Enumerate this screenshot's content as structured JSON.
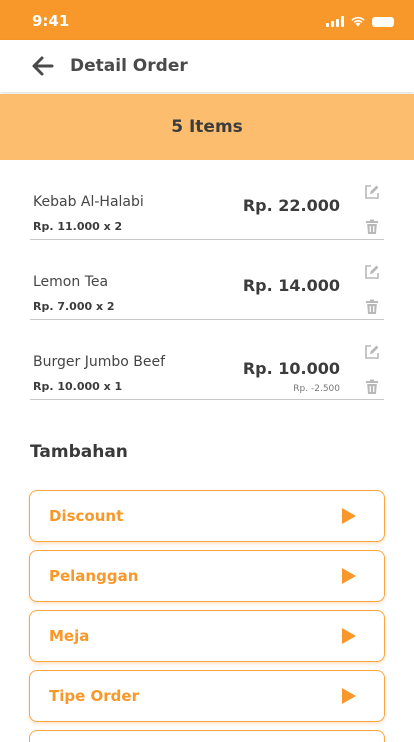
{
  "status_bar": {
    "time": "9:41"
  },
  "header": {
    "title": "Detail Order",
    "back_icon": "arrow-left-icon"
  },
  "banner": {
    "items_count": "5 Items"
  },
  "orders": [
    {
      "name": "Kebab Al-Halabi",
      "qty": "Rp. 11.000 x 2",
      "price": "Rp. 22.000",
      "discount": ""
    },
    {
      "name": "Lemon Tea",
      "qty": "Rp. 7.000 x 2",
      "price": "Rp. 14.000",
      "discount": ""
    },
    {
      "name": "Burger Jumbo Beef",
      "qty": "Rp. 10.000 x 1",
      "price": "Rp. 10.000",
      "discount": "Rp. -2.500"
    }
  ],
  "additional": {
    "title": "Tambahan",
    "options": [
      "Discount",
      "Pelanggan",
      "Meja",
      "Tipe Order"
    ]
  },
  "colors": {
    "accent": "#f8982a",
    "banner": "#fcbd6f",
    "icon_gray": "#b9b9b9"
  }
}
